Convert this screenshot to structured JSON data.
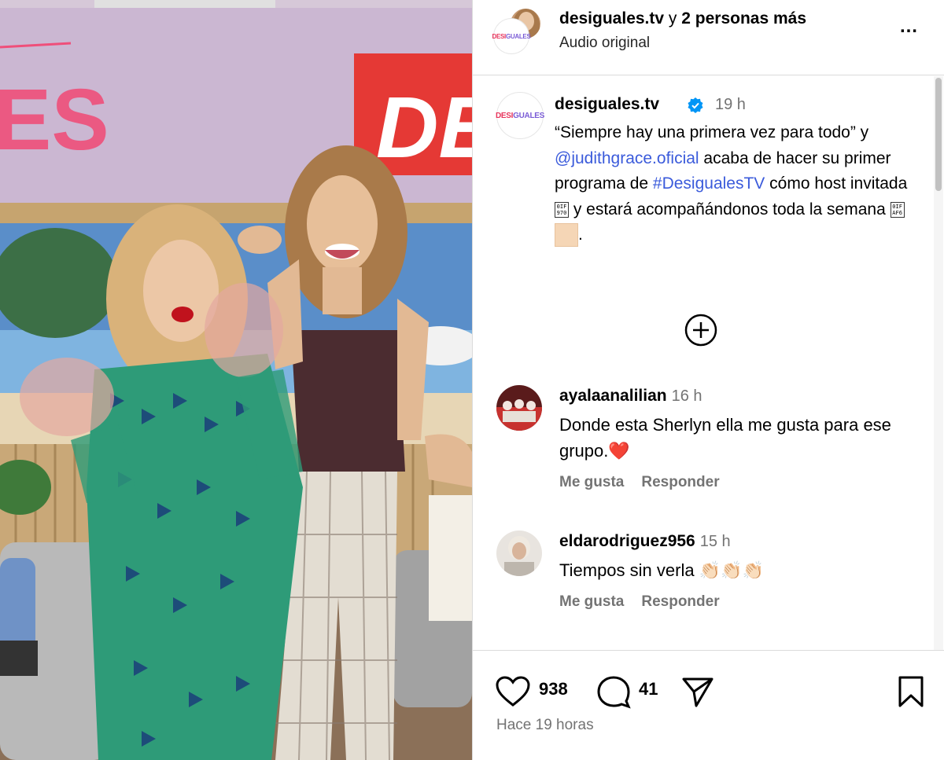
{
  "header": {
    "username": "desiguales.tv",
    "conjunction": "y",
    "others": "2 personas más",
    "subtitle": "Audio original",
    "more_icon": "…"
  },
  "post_logo": {
    "part1": "DESI",
    "part2": "GUALES"
  },
  "caption": {
    "username": "desiguales.tv",
    "time": "19 h",
    "line1": "“Siempre hay una primera vez para todo” y ",
    "mention": "@judithgrace.oficial",
    "line2": " acaba de hacer su primer programa de ",
    "hashtag": "#DesigualesTV",
    "line3": " cómo host invitada ",
    "line4": " y estará acompañándonos toda la semana ",
    "line5": ".",
    "emoji_tile_1": "0IF\n970",
    "emoji_tile_2": "0IF\nAF6"
  },
  "comments": [
    {
      "username": "ayalaanalilian",
      "time": "16 h",
      "text": "Donde esta Sherlyn ella me gusta para ese grupo.",
      "emoji": "❤️",
      "like_label": "Me gusta",
      "reply_label": "Responder"
    },
    {
      "username": "eldarodriguez956",
      "time": "15 h",
      "text": "Tiempos sin verla ",
      "emoji": "👏🏻👏🏻👏🏻",
      "like_label": "Me gusta",
      "reply_label": "Responder"
    }
  ],
  "footer": {
    "likes": "938",
    "comments_count": "41",
    "time_ago": "Hace 19 horas"
  },
  "media": {
    "studio_sign_left": "ES",
    "studio_sign_right": "DE"
  },
  "colors": {
    "link": "#3b5bdb",
    "verified": "#0095f6",
    "muted": "#737373",
    "brand_pink": "#e8365d",
    "brand_purple": "#7a5cd6"
  }
}
